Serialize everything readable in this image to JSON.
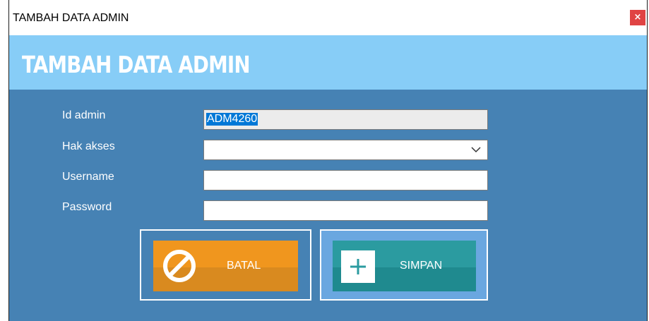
{
  "window": {
    "title": "TAMBAH DATA ADMIN",
    "close_glyph": "×"
  },
  "banner": {
    "title": "TAMBAH DATA ADMIN"
  },
  "form": {
    "id_admin": {
      "label": "Id admin",
      "value": "ADM4260"
    },
    "hak_akses": {
      "label": "Hak akses",
      "value": ""
    },
    "username": {
      "label": "Username",
      "value": ""
    },
    "password": {
      "label": "Password",
      "value": ""
    }
  },
  "buttons": {
    "batal": {
      "label": "BATAL",
      "icon": "cancel-icon"
    },
    "simpan": {
      "label": "SIMPAN",
      "icon": "plus-icon"
    }
  },
  "colors": {
    "banner": "#87cdf7",
    "content": "#4682b4",
    "batal": "#f0961e",
    "simpan": "#2b9ba0",
    "close": "#e04343"
  }
}
